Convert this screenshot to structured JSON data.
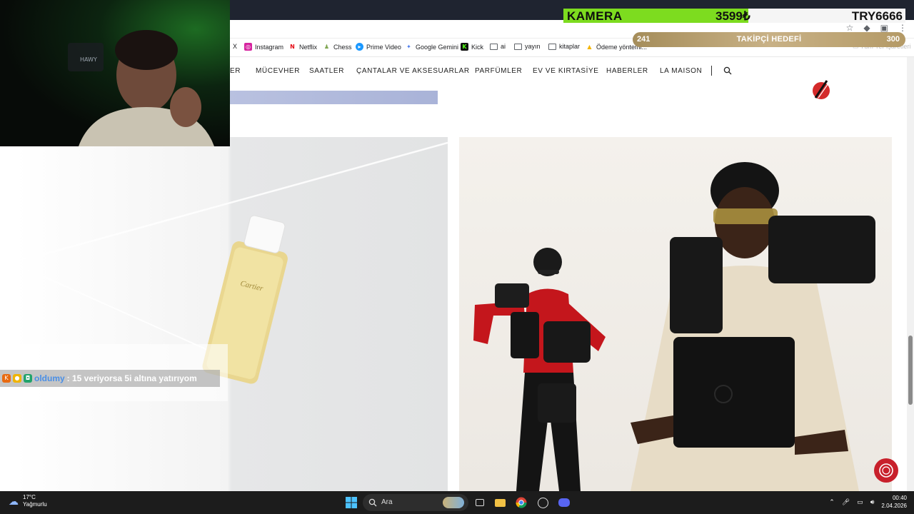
{
  "bookmarks": {
    "x_label": "X",
    "items": [
      {
        "label": "Instagram",
        "icon": "instagram-icon"
      },
      {
        "label": "Netflix",
        "icon": "netflix-icon"
      },
      {
        "label": "Chess",
        "icon": "chess-icon"
      },
      {
        "label": "Prime Video",
        "icon": "prime-video-icon"
      },
      {
        "label": "Google Gemini",
        "icon": "gemini-icon"
      },
      {
        "label": "Kick",
        "icon": "kick-icon"
      },
      {
        "label": "ai",
        "icon": "folder-icon"
      },
      {
        "label": "yayın",
        "icon": "folder-icon"
      },
      {
        "label": "kitaplar",
        "icon": "folder-icon"
      },
      {
        "label": "Ödeme yöntemi...",
        "icon": "google-ads-icon"
      }
    ],
    "all_bookmarks": "Tüm Yer İşaretleri"
  },
  "site_nav": {
    "items": [
      "ER",
      "MÜCEVHER",
      "SAATLER",
      "ÇANTALAR VE AKSESUARLAR",
      "PARFÜMLER",
      "EV VE KIRTASİYE",
      "HABERLER",
      "LA MAISON"
    ],
    "search_icon": "search-icon"
  },
  "stream": {
    "kamera_title": "KAMERA",
    "kamera_amount": "3599₺",
    "kamera_target": "TRY6666",
    "kamera_progress": 0.54,
    "followers_current": "241",
    "followers_title": "TAKİPÇİ HEDEFİ",
    "followers_goal": "300",
    "followers_progress": 0.8,
    "chat_user": "oldumy",
    "chat_message": ": 15 veriyorsa 5i altına yatırıyom"
  },
  "taskbar": {
    "temp": "17°C",
    "weather": "Yağmurlu",
    "search_label": "Ara",
    "time": "00:40",
    "date": "2.04.2026"
  },
  "colors": {
    "accent_red": "#c8202b",
    "kamera_green": "#7ddc1f",
    "follower_gold": "#b49a66"
  }
}
